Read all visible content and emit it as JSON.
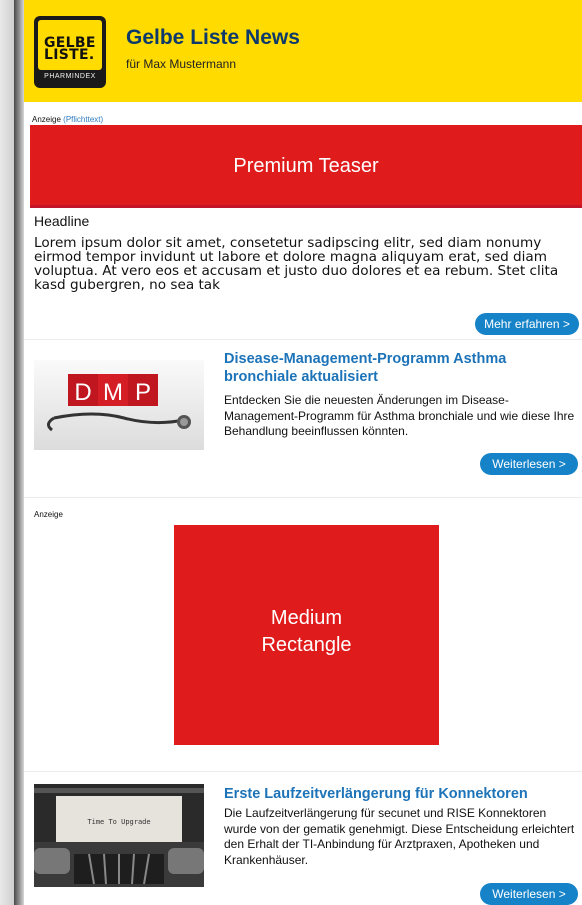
{
  "header": {
    "logo": {
      "line1": "GELBE",
      "line2": "LISTE.",
      "sub": "PHARMINDEX"
    },
    "title": "Gelbe Liste News",
    "subtitle": "für Max Mustermann"
  },
  "top_ad": {
    "label": "Anzeige",
    "link": "(Pflichttext)",
    "banner": "Premium Teaser",
    "headline": "Headline",
    "body": "Lorem ipsum dolor sit amet, consetetur sadipscing elitr, sed diam nonumy eirmod tempor invidunt ut labore et dolore magna aliquyam erat, sed diam voluptua. At vero eos et accusam et justo duo dolores et ea rebum. Stet clita kasd gubergren, no sea tak",
    "button": "Mehr erfahren >"
  },
  "articles": [
    {
      "title": "Disease-Management-Programm Asthma bronchiale aktualisiert",
      "text": "Entdecken Sie die neuesten Änderungen im Disease-Management-Programm für Asthma bronchiale und wie diese Ihre Behandlung beeinflussen könnten.",
      "image_text": "DMP",
      "button": "Weiterlesen >"
    },
    {
      "title": "Erste Laufzeitverlängerung für Konnektoren",
      "text": "Die Laufzeitverlängerung für secunet und RISE Konnektoren wurde von der gematik genehmigt. Diese Entscheidung erleichtert den Erhalt der TI-Anbindung für Arztpraxen, Apotheken und Krankenhäuser.",
      "image_text": "Time To Upgrade",
      "button": "Weiterlesen >"
    }
  ],
  "middle_ad": {
    "label": "Anzeige",
    "line1": "Medium",
    "line2": "Rectangle"
  },
  "colors": {
    "header_bg": "#ffdb00",
    "title": "#0d3a6b",
    "ad_red": "#e01b1b",
    "link_blue": "#1d73b8",
    "button_blue": "#1683c9"
  }
}
